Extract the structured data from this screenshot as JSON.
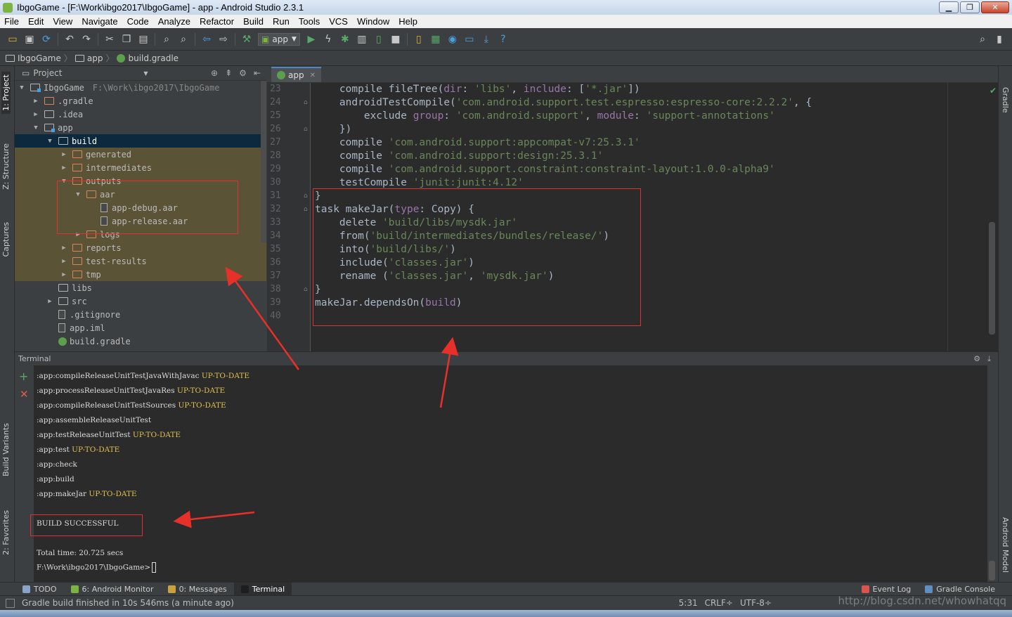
{
  "window": {
    "title": "IbgoGame - [F:\\Work\\ibgo2017\\IbgoGame] - app - Android Studio 2.3.1",
    "minimize": "▁",
    "restore": "❐",
    "close": "✕"
  },
  "menu": [
    "File",
    "Edit",
    "View",
    "Navigate",
    "Code",
    "Analyze",
    "Refactor",
    "Build",
    "Run",
    "Tools",
    "VCS",
    "Window",
    "Help"
  ],
  "toolbar": {
    "run_config": "app",
    "icons": [
      "open-icon",
      "save-icon",
      "sync-icon",
      "undo-icon",
      "redo-icon",
      "cut-icon",
      "copy-icon",
      "paste-icon",
      "find-icon",
      "replace-icon",
      "back-icon",
      "forward-icon",
      "make-icon",
      "run-icon",
      "apply-changes-icon",
      "debug-icon",
      "profile-icon",
      "attach-icon",
      "stop-icon",
      "avd-manager-icon",
      "sdk-manager-icon",
      "project-structure-icon",
      "gradle-sync-icon",
      "help-icon"
    ]
  },
  "breadcrumb": [
    "IbgoGame",
    "app",
    "build.gradle"
  ],
  "left_tabs": [
    "1: Project",
    "Z: Structure",
    "Captures",
    "Build Variants",
    "2: Favorites"
  ],
  "right_tabs": [
    "Gradle",
    "Android Model"
  ],
  "project": {
    "header": "Project",
    "tree": [
      {
        "indent": 0,
        "arrow": "▼",
        "icon": "module",
        "label": "IbgoGame",
        "hint": "F:\\Work\\ibgo2017\\IbgoGame"
      },
      {
        "indent": 1,
        "arrow": "▶",
        "icon": "orange",
        "label": ".gradle"
      },
      {
        "indent": 1,
        "arrow": "▶",
        "icon": "folder",
        "label": ".idea"
      },
      {
        "indent": 1,
        "arrow": "▼",
        "icon": "module",
        "label": "app"
      },
      {
        "indent": 2,
        "arrow": "▼",
        "icon": "folder",
        "label": "build",
        "selected": true
      },
      {
        "indent": 3,
        "arrow": "▶",
        "icon": "orange",
        "label": "generated",
        "excluded": true
      },
      {
        "indent": 3,
        "arrow": "▶",
        "icon": "orange",
        "label": "intermediates",
        "excluded": true
      },
      {
        "indent": 3,
        "arrow": "▼",
        "icon": "orange",
        "label": "outputs",
        "excluded": true
      },
      {
        "indent": 4,
        "arrow": "▼",
        "icon": "orange",
        "label": "aar",
        "excluded": true
      },
      {
        "indent": 5,
        "arrow": "",
        "icon": "file",
        "label": "app-debug.aar",
        "excluded": true
      },
      {
        "indent": 5,
        "arrow": "",
        "icon": "file",
        "label": "app-release.aar",
        "excluded": true
      },
      {
        "indent": 4,
        "arrow": "▶",
        "icon": "orange",
        "label": "logs",
        "excluded": true
      },
      {
        "indent": 3,
        "arrow": "▶",
        "icon": "orange",
        "label": "reports",
        "excluded": true
      },
      {
        "indent": 3,
        "arrow": "▶",
        "icon": "orange",
        "label": "test-results",
        "excluded": true
      },
      {
        "indent": 3,
        "arrow": "▶",
        "icon": "orange",
        "label": "tmp",
        "excluded": true
      },
      {
        "indent": 2,
        "arrow": "",
        "icon": "folder",
        "label": "libs"
      },
      {
        "indent": 2,
        "arrow": "▶",
        "icon": "folder",
        "label": "src"
      },
      {
        "indent": 2,
        "arrow": "",
        "icon": "file",
        "label": ".gitignore"
      },
      {
        "indent": 2,
        "arrow": "",
        "icon": "file",
        "label": "app.iml"
      },
      {
        "indent": 2,
        "arrow": "",
        "icon": "gradle",
        "label": "build.gradle"
      }
    ]
  },
  "editor": {
    "tab": "app",
    "lines": [
      {
        "n": "23",
        "t": [
          [
            "p",
            "    compile fileTree("
          ],
          [
            "a",
            "dir"
          ],
          [
            "p",
            ": "
          ],
          [
            "s",
            "'libs'"
          ],
          [
            "p",
            ", "
          ],
          [
            "a",
            "include"
          ],
          [
            "p",
            ": ["
          ],
          [
            "s",
            "'*.jar'"
          ],
          [
            "p",
            "])"
          ]
        ]
      },
      {
        "n": "24",
        "t": [
          [
            "p",
            "    androidTestCompile("
          ],
          [
            "s",
            "'com.android.support.test.espresso:espresso-core:2.2.2'"
          ],
          [
            "p",
            ", {"
          ]
        ]
      },
      {
        "n": "25",
        "t": [
          [
            "p",
            "        exclude "
          ],
          [
            "a",
            "group"
          ],
          [
            "p",
            ": "
          ],
          [
            "s",
            "'com.android.support'"
          ],
          [
            "p",
            ", "
          ],
          [
            "a",
            "module"
          ],
          [
            "p",
            ": "
          ],
          [
            "s",
            "'support-annotations'"
          ]
        ]
      },
      {
        "n": "26",
        "t": [
          [
            "p",
            "    })"
          ]
        ]
      },
      {
        "n": "27",
        "t": [
          [
            "p",
            "    compile "
          ],
          [
            "s",
            "'com.android.support:appcompat-v7:25.3.1'"
          ]
        ]
      },
      {
        "n": "28",
        "t": [
          [
            "p",
            "    compile "
          ],
          [
            "s",
            "'com.android.support:design:25.3.1'"
          ]
        ]
      },
      {
        "n": "29",
        "t": [
          [
            "p",
            "    compile "
          ],
          [
            "s",
            "'com.android.support.constraint:constraint-layout:1.0.0-alpha9'"
          ]
        ]
      },
      {
        "n": "30",
        "t": [
          [
            "p",
            "    testCompile "
          ],
          [
            "s",
            "'junit:junit:4.12'"
          ]
        ]
      },
      {
        "n": "31",
        "t": [
          [
            "p",
            "}"
          ]
        ]
      },
      {
        "n": "32",
        "t": [
          [
            "p",
            "task makeJar("
          ],
          [
            "a",
            "type"
          ],
          [
            "p",
            ": Copy) {"
          ]
        ]
      },
      {
        "n": "33",
        "t": [
          [
            "p",
            "    delete "
          ],
          [
            "s",
            "'build/libs/mysdk.jar'"
          ]
        ]
      },
      {
        "n": "34",
        "t": [
          [
            "p",
            "    from("
          ],
          [
            "s",
            "'build/intermediates/bundles/release/'"
          ],
          [
            "p",
            ")"
          ]
        ]
      },
      {
        "n": "35",
        "t": [
          [
            "p",
            "    into("
          ],
          [
            "s",
            "'build/libs/'"
          ],
          [
            "p",
            ")"
          ]
        ]
      },
      {
        "n": "36",
        "t": [
          [
            "p",
            "    include("
          ],
          [
            "s",
            "'classes.jar'"
          ],
          [
            "p",
            ")"
          ]
        ]
      },
      {
        "n": "37",
        "t": [
          [
            "p",
            "    rename ("
          ],
          [
            "s",
            "'classes.jar'"
          ],
          [
            "p",
            ", "
          ],
          [
            "s",
            "'mysdk.jar'"
          ],
          [
            "p",
            ")"
          ]
        ]
      },
      {
        "n": "38",
        "t": [
          [
            "p",
            "}"
          ]
        ]
      },
      {
        "n": "39",
        "t": [
          [
            "p",
            "makeJar.dependsOn("
          ],
          [
            "a",
            "build"
          ],
          [
            "p",
            ")"
          ]
        ]
      },
      {
        "n": "40",
        "t": []
      }
    ]
  },
  "terminal": {
    "header": "Terminal",
    "lines": [
      {
        "text": ":app:compileReleaseUnitTestJavaWithJavac ",
        "status": "UP-TO-DATE"
      },
      {
        "text": ":app:processReleaseUnitTestJavaRes ",
        "status": "UP-TO-DATE"
      },
      {
        "text": ":app:compileReleaseUnitTestSources ",
        "status": "UP-TO-DATE"
      },
      {
        "text": ":app:assembleReleaseUnitTest",
        "status": ""
      },
      {
        "text": ":app:testReleaseUnitTest ",
        "status": "UP-TO-DATE"
      },
      {
        "text": ":app:test ",
        "status": "UP-TO-DATE"
      },
      {
        "text": ":app:check",
        "status": ""
      },
      {
        "text": ":app:build",
        "status": ""
      },
      {
        "text": ":app:makeJar ",
        "status": "UP-TO-DATE"
      }
    ],
    "build_result": "BUILD SUCCESSFUL",
    "total_time": "Total time: 20.725 secs",
    "prompt": "F:\\Work\\ibgo2017\\IbgoGame>"
  },
  "bottom_tabs": [
    {
      "label": "TODO",
      "color": "#8aa4c8"
    },
    {
      "label": "6: Android Monitor",
      "color": "#7cb342"
    },
    {
      "label": "0: Messages",
      "color": "#c9a33a"
    },
    {
      "label": "Terminal",
      "color": "#1e1e1e",
      "active": true
    }
  ],
  "bottom_right_tabs": [
    {
      "label": "Event Log",
      "color": "#d9534f"
    },
    {
      "label": "Gradle Console",
      "color": "#5f8fbf"
    }
  ],
  "status": {
    "message": "Gradle build finished in 10s 546ms (a minute ago)",
    "position": "5:31",
    "line_sep": "CRLF÷",
    "encoding": "UTF-8÷"
  },
  "watermark": "http://blog.csdn.net/whowhatqq"
}
